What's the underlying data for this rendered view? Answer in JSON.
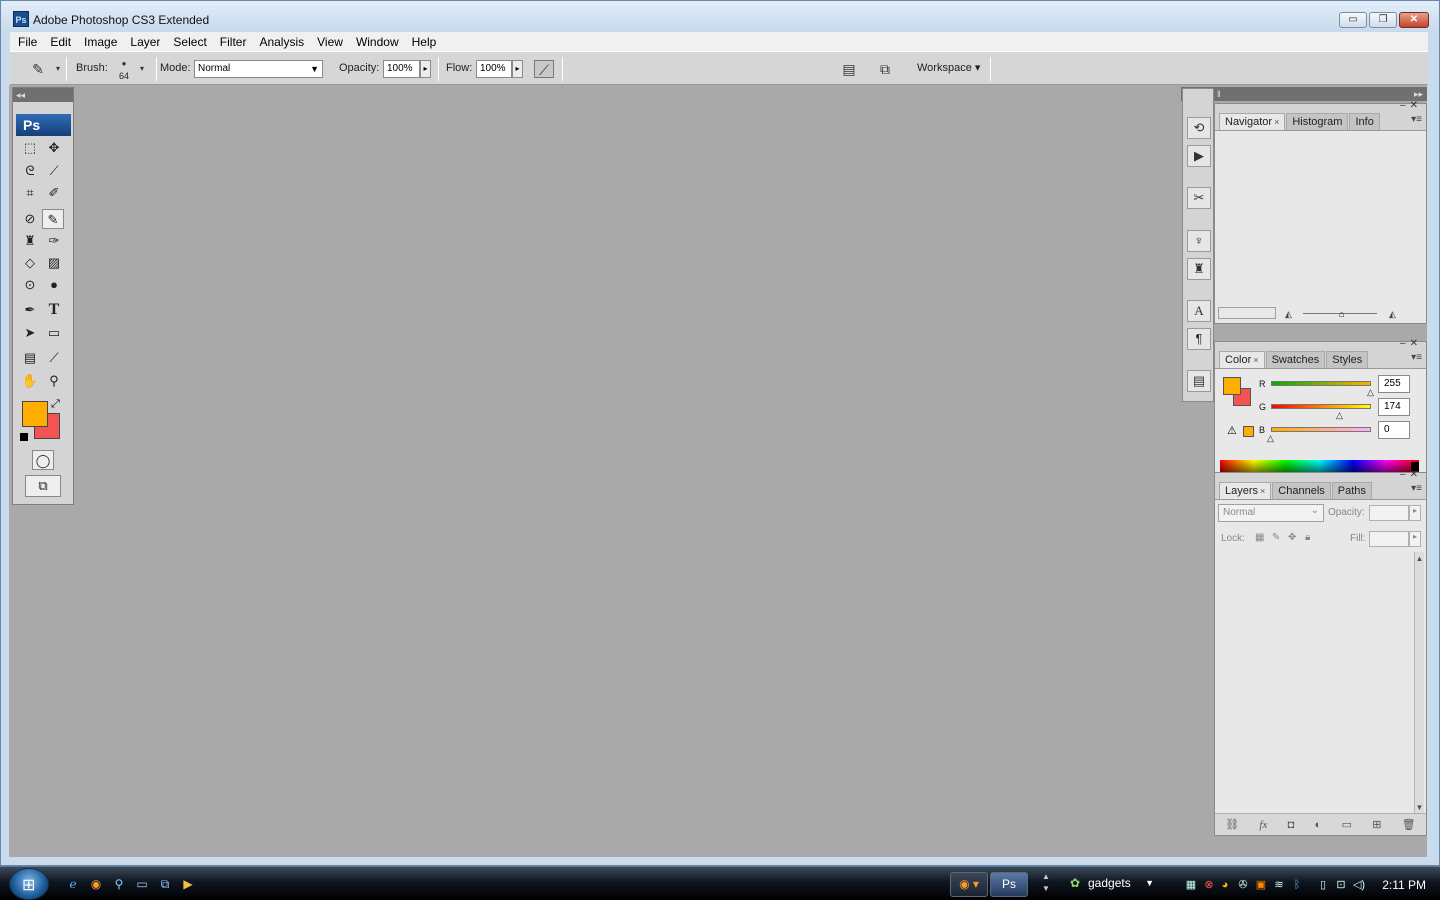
{
  "window": {
    "app_icon": "Ps",
    "title": "Adobe Photoshop CS3 Extended",
    "buttons": {
      "minimize": "▭",
      "restore": "❐",
      "close": "✕"
    }
  },
  "menu": [
    "File",
    "Edit",
    "Image",
    "Layer",
    "Select",
    "Filter",
    "Analysis",
    "View",
    "Window",
    "Help"
  ],
  "options_bar": {
    "brush_label": "Brush:",
    "brush_size": "64",
    "mode_label": "Mode:",
    "mode_value": "Normal",
    "opacity_label": "Opacity:",
    "opacity_value": "100%",
    "flow_label": "Flow:",
    "flow_value": "100%",
    "workspace_label": "Workspace ▾"
  },
  "toolbox": {
    "logo": "Ps",
    "foreground_color": "#ffae00",
    "background_color": "#f25454"
  },
  "navigator_panel": {
    "tabs": [
      {
        "label": "Navigator",
        "close": "×"
      },
      {
        "label": "Histogram"
      },
      {
        "label": "Info"
      }
    ]
  },
  "color_panel": {
    "tabs": [
      {
        "label": "Color",
        "close": "×"
      },
      {
        "label": "Swatches"
      },
      {
        "label": "Styles"
      }
    ],
    "r_label": "R",
    "r_value": "255",
    "g_label": "G",
    "g_value": "174",
    "b_label": "B",
    "b_value": "0"
  },
  "layers_panel": {
    "tabs": [
      {
        "label": "Layers",
        "close": "×"
      },
      {
        "label": "Channels"
      },
      {
        "label": "Paths"
      }
    ],
    "blend_mode": "Normal",
    "opacity_label": "Opacity:",
    "lock_label": "Lock:",
    "fill_label": "Fill:"
  },
  "taskbar": {
    "task_gadgets": "gadgets",
    "clock": "2:11 PM"
  },
  "colors": {
    "canvas_bg": "#a9a9a9",
    "panel_bg": "#d4d4d4",
    "accent": "#1b4c8c"
  }
}
